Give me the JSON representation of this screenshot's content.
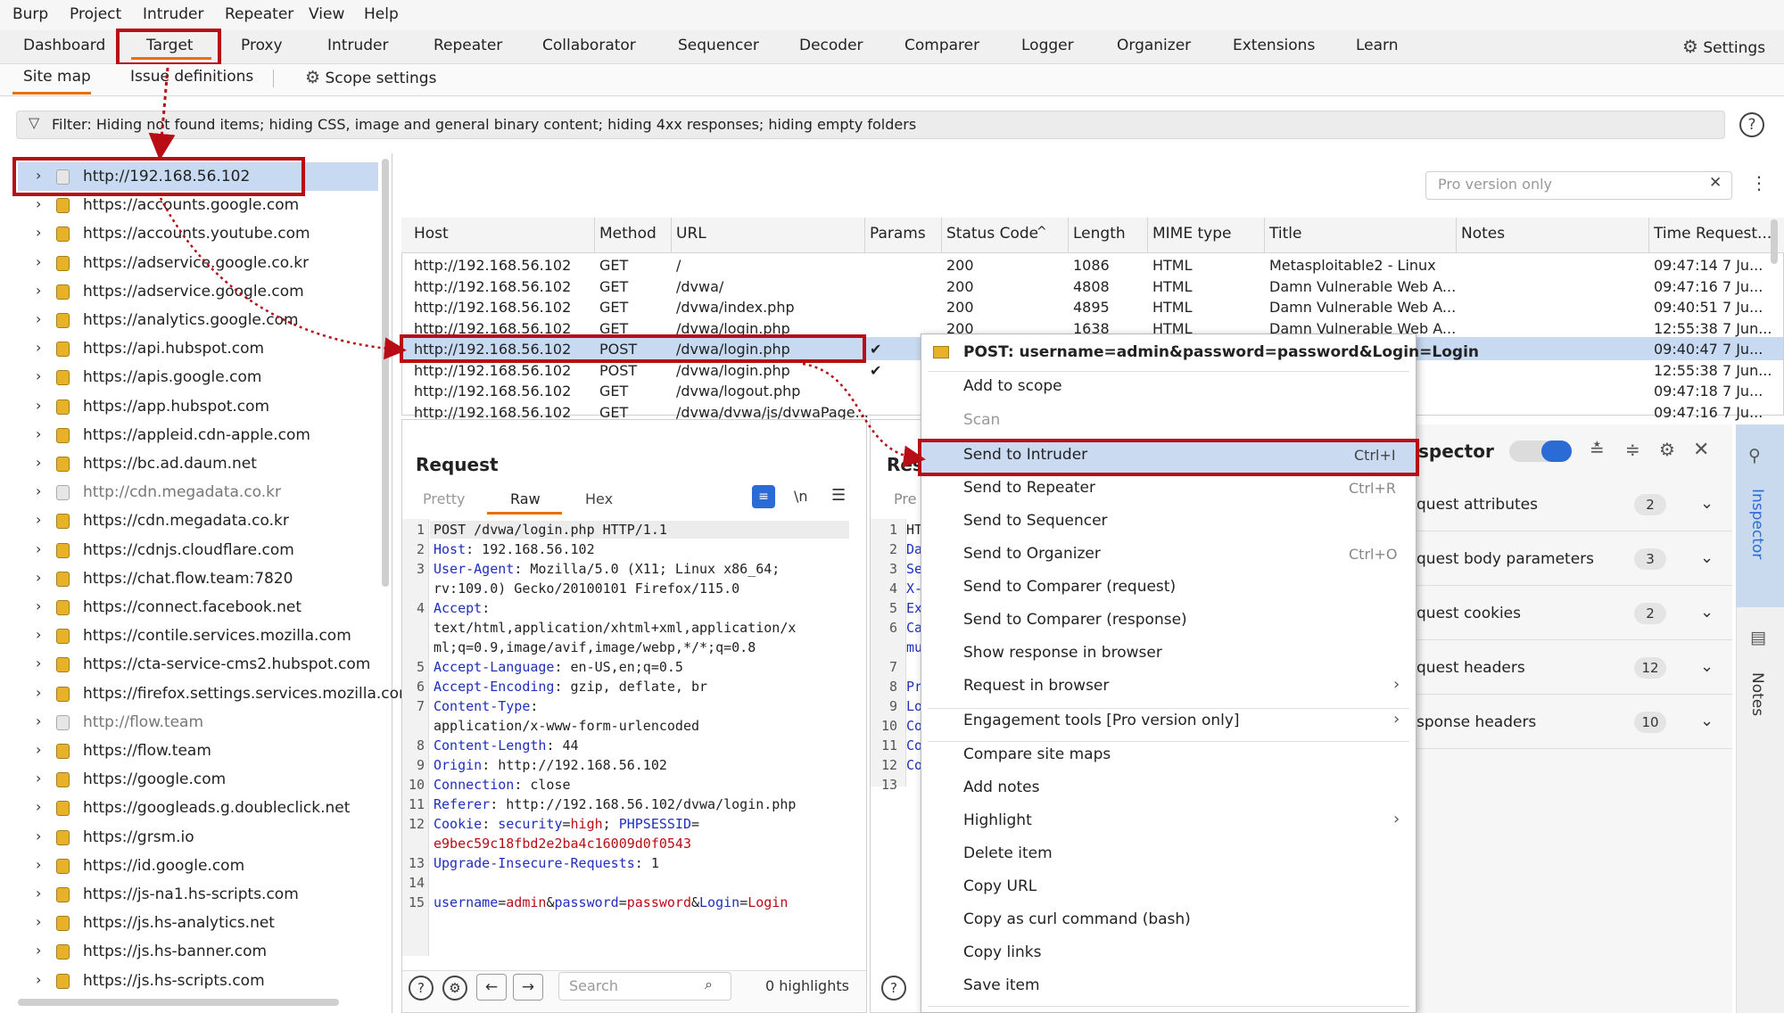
{
  "menubar": [
    "Burp",
    "Project",
    "Intruder",
    "Repeater",
    "View",
    "Help"
  ],
  "tabs": [
    "Dashboard",
    "Target",
    "Proxy",
    "Intruder",
    "Repeater",
    "Collaborator",
    "Sequencer",
    "Decoder",
    "Comparer",
    "Logger",
    "Organizer",
    "Extensions",
    "Learn"
  ],
  "settings_label": "Settings",
  "subtabs": {
    "site_map": "Site map",
    "issue_definitions": "Issue definitions",
    "scope_settings": "Scope settings"
  },
  "filter": "Filter: Hiding not found items;  hiding CSS, image and general binary content;  hiding 4xx responses;  hiding empty folders",
  "tree": [
    {
      "label": "http://192.168.56.102",
      "icon": "doc",
      "dim": false
    },
    {
      "label": "https://accounts.google.com",
      "icon": "lock"
    },
    {
      "label": "https://accounts.youtube.com",
      "icon": "lock"
    },
    {
      "label": "https://adservice.google.co.kr",
      "icon": "lock"
    },
    {
      "label": "https://adservice.google.com",
      "icon": "lock"
    },
    {
      "label": "https://analytics.google.com",
      "icon": "lock"
    },
    {
      "label": "https://api.hubspot.com",
      "icon": "lock"
    },
    {
      "label": "https://apis.google.com",
      "icon": "lock"
    },
    {
      "label": "https://app.hubspot.com",
      "icon": "lock"
    },
    {
      "label": "https://appleid.cdn-apple.com",
      "icon": "lock"
    },
    {
      "label": "https://bc.ad.daum.net",
      "icon": "lock"
    },
    {
      "label": "http://cdn.megadata.co.kr",
      "icon": "doc",
      "dim": true
    },
    {
      "label": "https://cdn.megadata.co.kr",
      "icon": "lock"
    },
    {
      "label": "https://cdnjs.cloudflare.com",
      "icon": "lock"
    },
    {
      "label": "https://chat.flow.team:7820",
      "icon": "lock"
    },
    {
      "label": "https://connect.facebook.net",
      "icon": "lock"
    },
    {
      "label": "https://contile.services.mozilla.com",
      "icon": "lock"
    },
    {
      "label": "https://cta-service-cms2.hubspot.com",
      "icon": "lock"
    },
    {
      "label": "https://firefox.settings.services.mozilla.cor",
      "icon": "lock"
    },
    {
      "label": "http://flow.team",
      "icon": "doc",
      "dim": true
    },
    {
      "label": "https://flow.team",
      "icon": "lock"
    },
    {
      "label": "https://google.com",
      "icon": "lock"
    },
    {
      "label": "https://googleads.g.doubleclick.net",
      "icon": "lock"
    },
    {
      "label": "https://grsm.io",
      "icon": "lock"
    },
    {
      "label": "https://id.google.com",
      "icon": "lock"
    },
    {
      "label": "https://js-na1.hs-scripts.com",
      "icon": "lock"
    },
    {
      "label": "https://js.hs-analytics.net",
      "icon": "lock"
    },
    {
      "label": "https://js.hs-banner.com",
      "icon": "lock"
    },
    {
      "label": "https://js.hs-scripts.com",
      "icon": "lock"
    }
  ],
  "search_placeholder": "Pro version only",
  "table": {
    "headers": [
      "Host",
      "Method",
      "URL",
      "Params",
      "Status Code",
      "Length",
      "MIME type",
      "Title",
      "Notes",
      "Time Request..."
    ],
    "rows": [
      [
        "http://192.168.56.102",
        "GET",
        "/",
        "",
        "200",
        "1086",
        "HTML",
        "Metasploitable2 - Linux",
        "",
        "09:47:14 7 Ju..."
      ],
      [
        "http://192.168.56.102",
        "GET",
        "/dvwa/",
        "",
        "200",
        "4808",
        "HTML",
        "Damn Vulnerable Web A...",
        "",
        "09:47:16 7 Ju..."
      ],
      [
        "http://192.168.56.102",
        "GET",
        "/dvwa/index.php",
        "",
        "200",
        "4895",
        "HTML",
        "Damn Vulnerable Web A...",
        "",
        "09:40:51 7 Ju..."
      ],
      [
        "http://192.168.56.102",
        "GET",
        "/dvwa/login.php",
        "",
        "200",
        "1638",
        "HTML",
        "Damn Vulnerable Web A...",
        "",
        "12:55:38 7 Jun..."
      ],
      [
        "http://192.168.56.102",
        "POST",
        "/dvwa/login.php",
        "✔",
        "",
        "",
        "",
        "",
        "",
        "09:40:47 7 Ju..."
      ],
      [
        "http://192.168.56.102",
        "POST",
        "/dvwa/login.php",
        "✔",
        "",
        "",
        "",
        "",
        "",
        "12:55:38 7 Jun..."
      ],
      [
        "http://192.168.56.102",
        "GET",
        "/dvwa/logout.php",
        "",
        "",
        "",
        "",
        "",
        "",
        "09:47:18 7 Ju..."
      ],
      [
        "http://192.168.56.102",
        "GET",
        "/dvwa/dvwa/js/dvwaPage...",
        "",
        "",
        "",
        "",
        "",
        "",
        "09:47:16 7 Ju..."
      ]
    ]
  },
  "request": {
    "title": "Request",
    "tabs": [
      "Pretty",
      "Raw",
      "Hex"
    ],
    "nl": "\\n",
    "search_placeholder": "Search",
    "highlights": "0 highlights"
  },
  "response": {
    "title": "Res",
    "tab": "Pre",
    "line_numbers": [
      "1",
      "2",
      "3",
      "4",
      "5",
      "6",
      "",
      "7",
      "8",
      "9",
      "10",
      "11",
      "12",
      "13"
    ],
    "prefixes": [
      "HT",
      "Da",
      "Se",
      "X-",
      "Ex",
      "Ca",
      "mu",
      "",
      "Pr",
      "Lo",
      "Co",
      "Co",
      "Co"
    ]
  },
  "inspector": {
    "title": "spector",
    "rows": [
      {
        "label": "quest attributes",
        "count": "2"
      },
      {
        "label": "quest body parameters",
        "count": "3"
      },
      {
        "label": "quest cookies",
        "count": "2"
      },
      {
        "label": "quest headers",
        "count": "12"
      },
      {
        "label": "sponse headers",
        "count": "10"
      }
    ]
  },
  "sidebar": {
    "inspector": "Inspector",
    "notes": "Notes"
  },
  "context_menu": {
    "header": "POST: username=admin&password=password&Login=Login",
    "items": [
      {
        "label": "Add to scope"
      },
      {
        "label": "Scan",
        "disabled": true
      },
      {
        "label": "Send to Intruder",
        "shortcut": "Ctrl+I"
      },
      {
        "label": "Send to Repeater",
        "shortcut": "Ctrl+R"
      },
      {
        "label": "Send to Sequencer"
      },
      {
        "label": "Send to Organizer",
        "shortcut": "Ctrl+O"
      },
      {
        "label": "Send to Comparer (request)"
      },
      {
        "label": "Send to Comparer (response)"
      },
      {
        "label": "Show response in browser"
      },
      {
        "label": "Request in browser",
        "submenu": true
      },
      {
        "label": "Engagement tools [Pro version only]",
        "submenu": true
      },
      {
        "label": "Compare site maps"
      },
      {
        "label": "Add notes"
      },
      {
        "label": "Highlight",
        "submenu": true
      },
      {
        "label": "Delete item"
      },
      {
        "label": "Copy URL"
      },
      {
        "label": "Copy as curl command (bash)"
      },
      {
        "label": "Copy links"
      },
      {
        "label": "Save item"
      }
    ]
  }
}
